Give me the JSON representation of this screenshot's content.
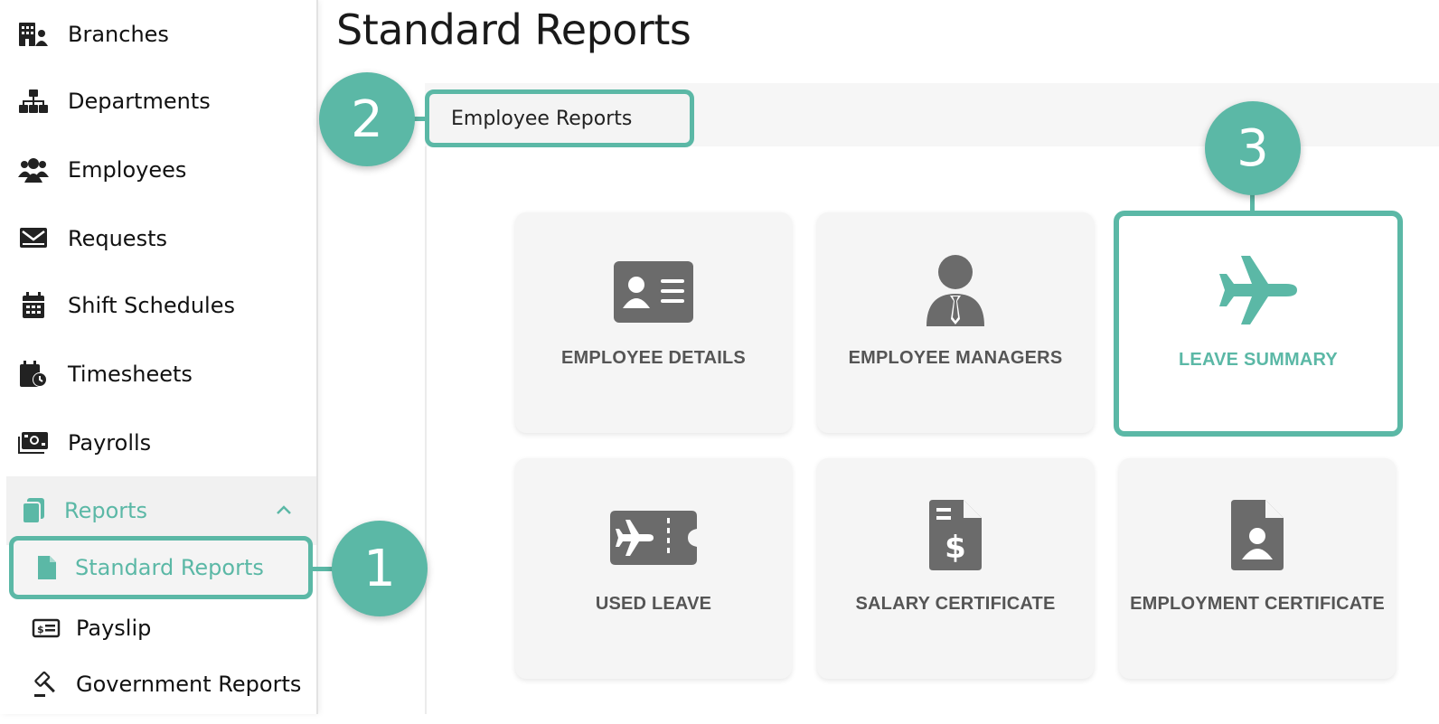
{
  "sidebar": {
    "items": [
      {
        "label": "Branches",
        "icon": "building-user-icon"
      },
      {
        "label": "Departments",
        "icon": "sitemap-icon"
      },
      {
        "label": "Employees",
        "icon": "users-icon"
      },
      {
        "label": "Requests",
        "icon": "envelope-open-icon"
      },
      {
        "label": "Shift Schedules",
        "icon": "calendar-icon"
      },
      {
        "label": "Timesheets",
        "icon": "calendar-clock-icon"
      },
      {
        "label": "Payrolls",
        "icon": "money-bill-icon"
      }
    ],
    "group": {
      "label": "Reports",
      "icon": "copy-icon",
      "expanded": true
    },
    "sub_items": [
      {
        "label": "Standard Reports",
        "icon": "file-icon",
        "active": true
      },
      {
        "label": "Payslip",
        "icon": "money-check-icon"
      },
      {
        "label": "Government Reports",
        "icon": "gavel-icon"
      }
    ]
  },
  "main": {
    "title": "Standard Reports",
    "tabs": [
      {
        "label": "Employee Reports",
        "active": true
      }
    ],
    "cards": [
      {
        "label": "EMPLOYEE DETAILS",
        "icon": "id-card-icon"
      },
      {
        "label": "EMPLOYEE MANAGERS",
        "icon": "user-tie-icon"
      },
      {
        "label": "LEAVE SUMMARY",
        "icon": "plane-icon",
        "highlighted": true
      },
      {
        "label": "USED LEAVE",
        "icon": "plane-ticket-icon"
      },
      {
        "label": "SALARY CERTIFICATE",
        "icon": "file-invoice-dollar-icon"
      },
      {
        "label": "EMPLOYMENT CERTIFICATE",
        "icon": "file-user-icon"
      }
    ]
  },
  "steps": [
    "1",
    "2",
    "3"
  ],
  "colors": {
    "accent": "#5bb8a6",
    "icon_gray": "#6b6b6b",
    "card_bg": "#f5f5f5"
  }
}
